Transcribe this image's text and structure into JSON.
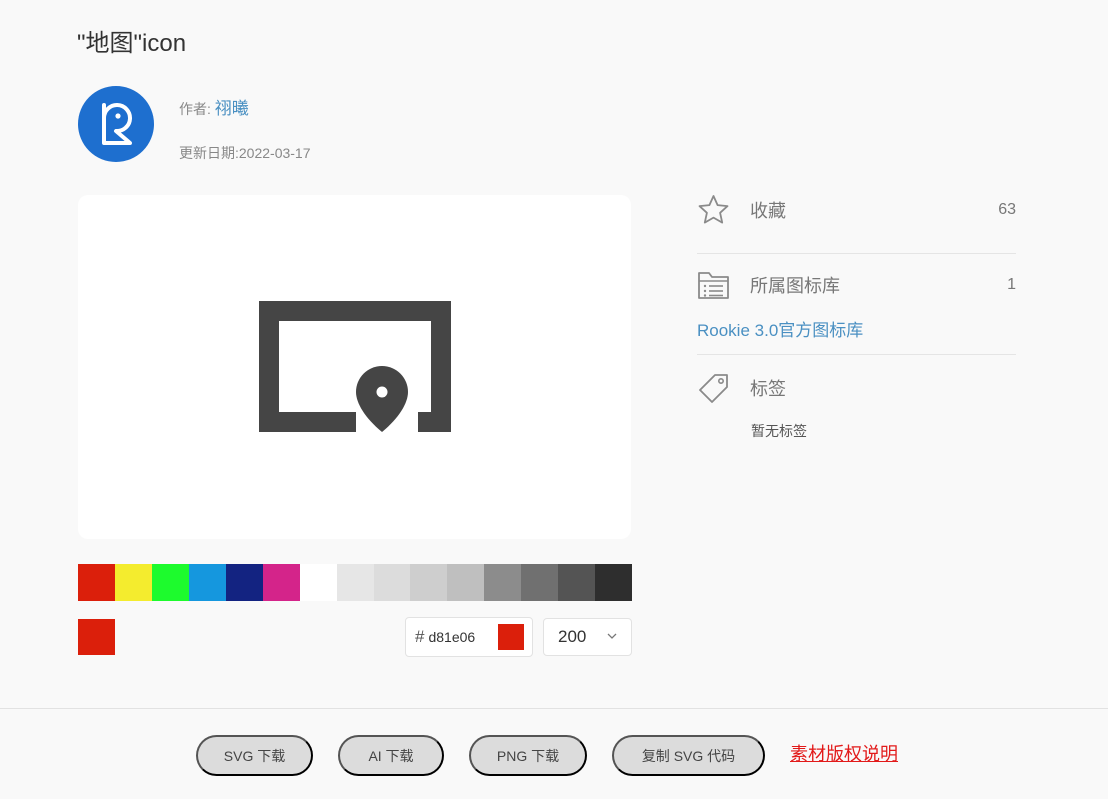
{
  "header": {
    "title": "\"地图\"icon"
  },
  "author": {
    "label": "作者:",
    "name": "祤曦"
  },
  "updated": {
    "label": "更新日期:",
    "date": "2022-03-17"
  },
  "preview": {
    "icon": "map-pin-frame-icon",
    "icon_color": "#454545"
  },
  "palette": {
    "colors": [
      "#db1f0b",
      "#f4ec2e",
      "#1dfb2d",
      "#1597de",
      "#132381",
      "#d4248a",
      "#ffffff",
      "#e6e6e6",
      "#dcdcdc",
      "#cecece",
      "#bfbfbf",
      "#8c8c8c",
      "#707070",
      "#545454",
      "#2e2e2e"
    ],
    "current": "#db1f0b"
  },
  "color_input": {
    "hash": "#",
    "value": "d81e06"
  },
  "size_select": {
    "value": "200",
    "icon": "chevron-down-icon"
  },
  "sidebar": {
    "favorites": {
      "icon": "star-icon",
      "label": "收藏",
      "count": "63"
    },
    "library": {
      "icon": "folder-list-icon",
      "label": "所属图标库",
      "count": "1",
      "link": "Rookie 3.0官方图标库"
    },
    "tags": {
      "icon": "tag-icon",
      "label": "标签",
      "empty": "暂无标签"
    }
  },
  "actions": {
    "svg_download": "SVG 下载",
    "ai_download": "AI 下载",
    "png_download": "PNG 下载",
    "copy_svg": "复制 SVG 代码",
    "copyright": "素材版权说明"
  }
}
